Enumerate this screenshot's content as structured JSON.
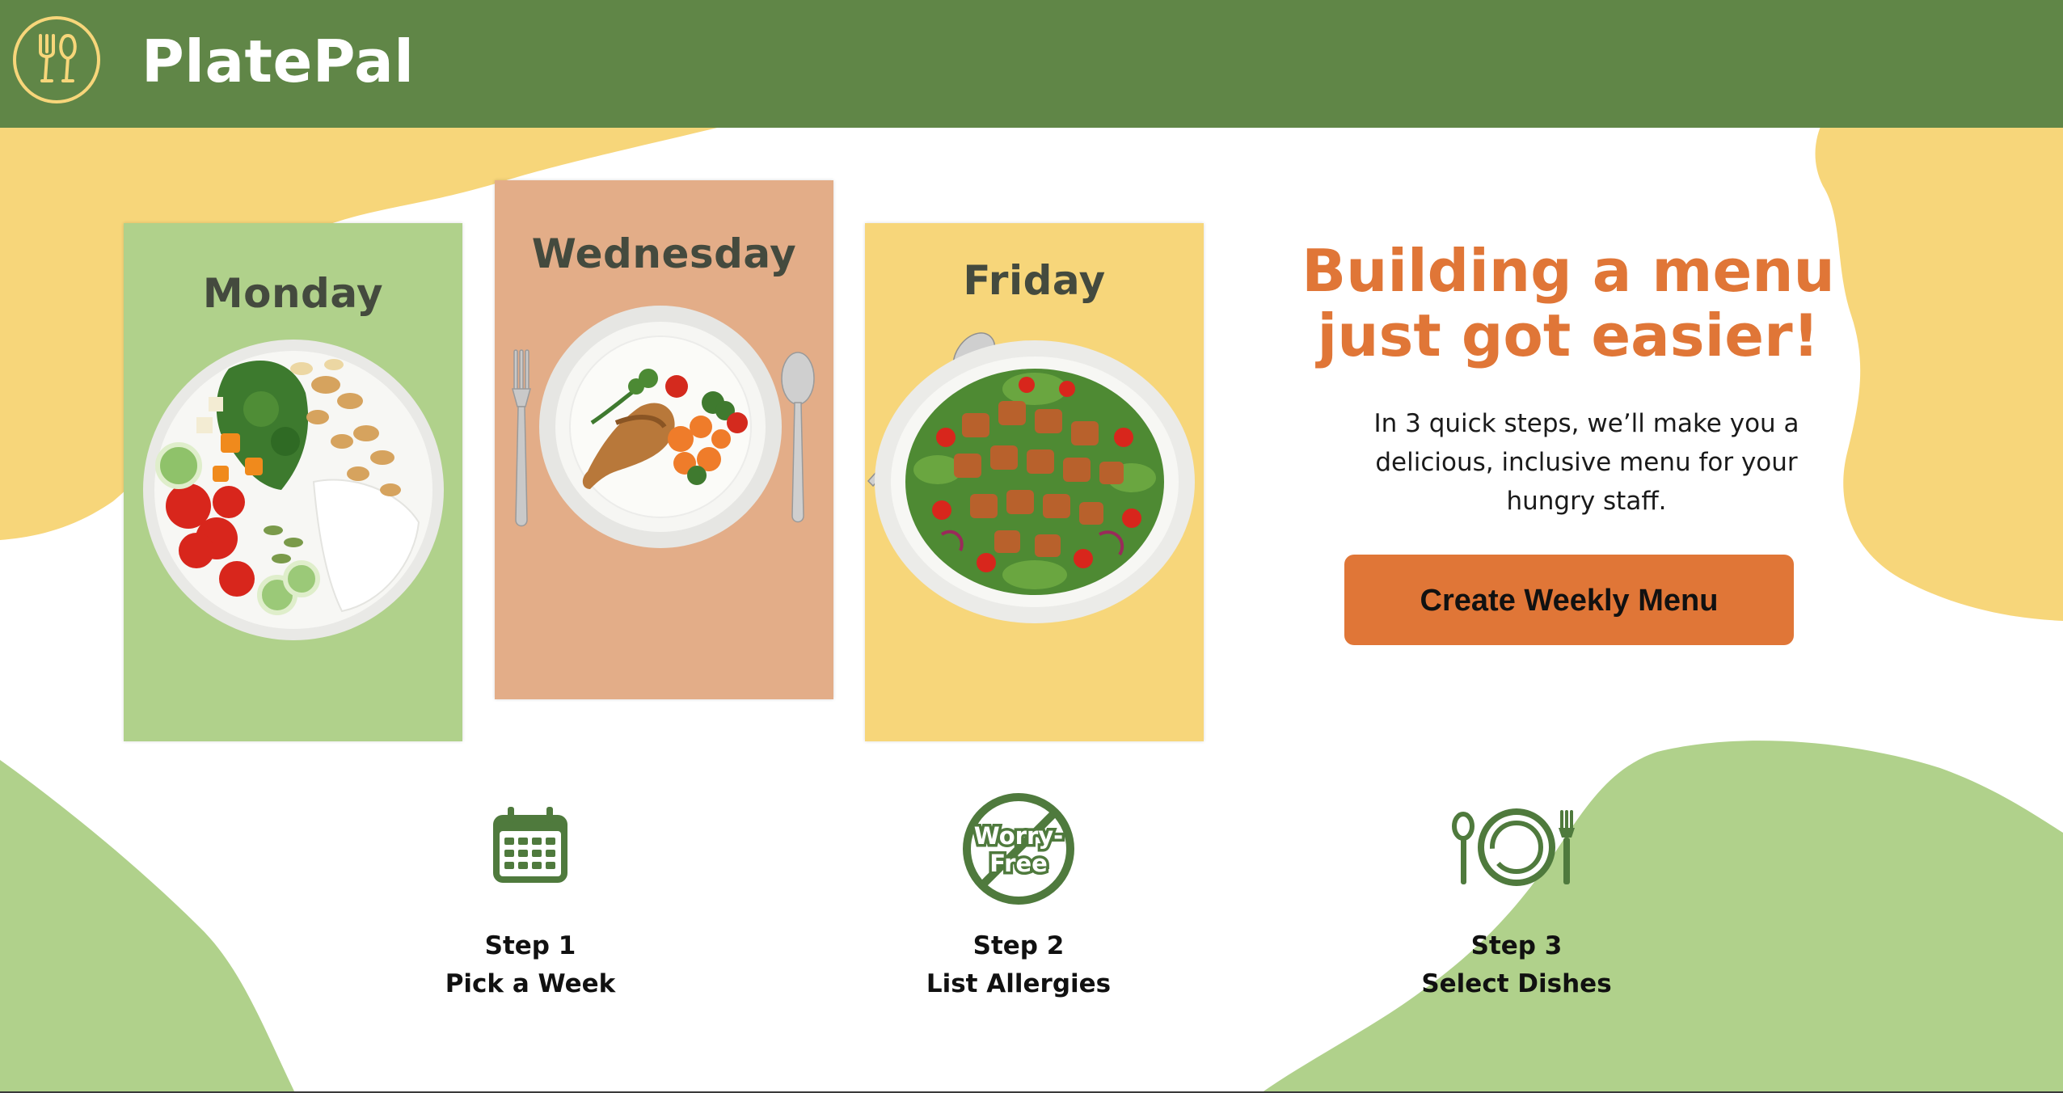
{
  "header": {
    "brand": "PlatePal",
    "logo_icon": "fork-spoon-icon",
    "background": "#608647",
    "accent": "#f7d67a"
  },
  "cards": [
    {
      "day": "Monday",
      "background": "#b0d18b",
      "image": "vegetable-rice-bowl"
    },
    {
      "day": "Wednesday",
      "background": "#e3ad88",
      "image": "chicken-leg-plate-with-fork-spoon"
    },
    {
      "day": "Friday",
      "background": "#f7d67a",
      "image": "chicken-salad-plate"
    }
  ],
  "hero": {
    "headline_line1": "Building a menu",
    "headline_line2": "just got easier!",
    "subtext_line1": "In 3 quick steps, we’ll make you a",
    "subtext_line2": "delicious, inclusive menu for your",
    "subtext_line3": "hungry staff.",
    "cta_label": "Create Weekly Menu",
    "accent": "#e07637"
  },
  "steps": [
    {
      "number": "Step 1",
      "label": "Pick a Week",
      "icon": "calendar-icon"
    },
    {
      "number": "Step 2",
      "label": "List Allergies",
      "icon": "worry-free-icon",
      "badge_line1": "Worry-",
      "badge_line2": "Free"
    },
    {
      "number": "Step 3",
      "label": "Select Dishes",
      "icon": "plate-cutlery-icon"
    }
  ],
  "colors": {
    "blob_yellow": "#f7d67a",
    "blob_green": "#b0d18b",
    "icon_green": "#4f7a3d"
  }
}
